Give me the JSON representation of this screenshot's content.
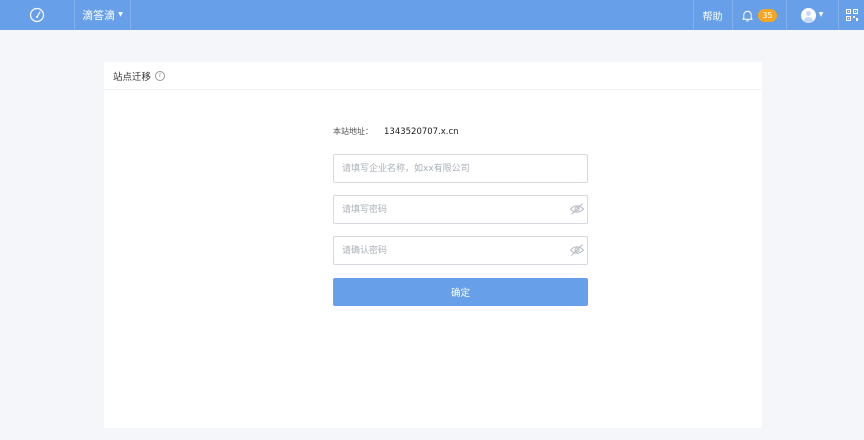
{
  "topbar": {
    "logo_icon": "speedometer-icon",
    "app_name": "滴答滴",
    "help_label": "帮助",
    "notification_count": "35",
    "bell_icon": "bell-icon",
    "qr_icon": "qr-code-icon"
  },
  "card": {
    "title": "站点迁移",
    "info_icon": "info-icon"
  },
  "form": {
    "site_address_label": "本站地址：",
    "site_address_value": "1343520707.x.cn",
    "company_placeholder": "请填写企业名称，如xx有限公司",
    "password_placeholder": "请填写密码",
    "confirm_placeholder": "请确认密码",
    "submit_label": "确定",
    "eye_icon": "eye-slash-icon"
  },
  "colors": {
    "topbar_bg": "#67a0e8",
    "badge_bg": "#f5a623",
    "submit_bg": "#67a0e8",
    "page_bg": "#f4f6f9"
  }
}
